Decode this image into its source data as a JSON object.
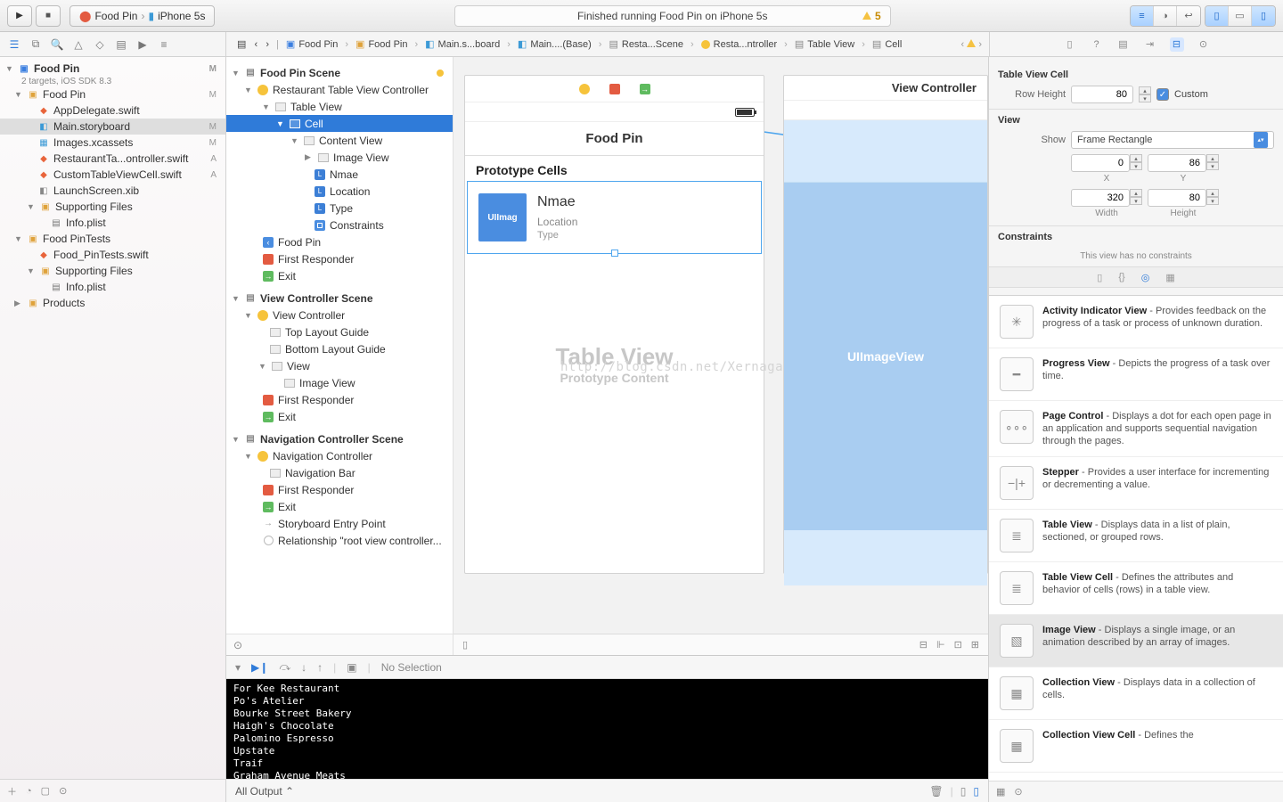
{
  "toolbar": {
    "scheme_app": "Food Pin",
    "scheme_device": "iPhone 5s",
    "status_text": "Finished running Food Pin on iPhone 5s",
    "warning_count": "5"
  },
  "breadcrumb": [
    "Food Pin",
    "Food Pin",
    "Main.s...board",
    "Main....(Base)",
    "Resta...Scene",
    "Resta...ntroller",
    "Table View",
    "Cell"
  ],
  "navigator": {
    "project": {
      "name": "Food Pin",
      "subtitle": "2 targets, iOS SDK 8.3",
      "tag": "M"
    },
    "groups": [
      {
        "name": "Food Pin",
        "tag": "M",
        "items": [
          {
            "name": "AppDelegate.swift",
            "kind": "swift"
          },
          {
            "name": "Main.storyboard",
            "kind": "sb",
            "tag": "M",
            "sel": true
          },
          {
            "name": "Images.xcassets",
            "kind": "xc",
            "tag": "M"
          },
          {
            "name": "RestaurantTa...ontroller.swift",
            "kind": "swift",
            "tag": "A"
          },
          {
            "name": "CustomTableViewCell.swift",
            "kind": "swift",
            "tag": "A"
          },
          {
            "name": "LaunchScreen.xib",
            "kind": "xib"
          }
        ],
        "subgroups": [
          {
            "name": "Supporting Files",
            "items": [
              {
                "name": "Info.plist",
                "kind": "plist"
              }
            ]
          }
        ]
      },
      {
        "name": "Food PinTests",
        "items": [
          {
            "name": "Food_PinTests.swift",
            "kind": "swift"
          }
        ],
        "subgroups": [
          {
            "name": "Supporting Files",
            "items": [
              {
                "name": "Info.plist",
                "kind": "plist"
              }
            ]
          }
        ]
      },
      {
        "name": "Products",
        "collapsed": true
      }
    ]
  },
  "outline": {
    "scenes": [
      {
        "title": "Food Pin Scene",
        "children": [
          {
            "label": "Restaurant Table View Controller",
            "icon": "yellow",
            "children": [
              {
                "label": "Table View",
                "icon": "rect",
                "children": [
                  {
                    "label": "Cell",
                    "icon": "rect",
                    "sel": true,
                    "children": [
                      {
                        "label": "Content View",
                        "icon": "rect",
                        "children": [
                          {
                            "label": "Image View",
                            "icon": "rect",
                            "leaf": true
                          },
                          {
                            "label": "Nmae",
                            "icon": "L"
                          },
                          {
                            "label": "Location",
                            "icon": "L"
                          },
                          {
                            "label": "Type",
                            "icon": "L"
                          },
                          {
                            "label": "Constraints",
                            "icon": "con"
                          }
                        ]
                      }
                    ]
                  }
                ]
              }
            ]
          },
          {
            "label": "Food Pin",
            "icon": "back"
          },
          {
            "label": "First Responder",
            "icon": "cube"
          },
          {
            "label": "Exit",
            "icon": "exit"
          }
        ]
      },
      {
        "title": "View Controller Scene",
        "children": [
          {
            "label": "View Controller",
            "icon": "yellow",
            "children": [
              {
                "label": "Top Layout Guide",
                "icon": "rect"
              },
              {
                "label": "Bottom Layout Guide",
                "icon": "rect"
              },
              {
                "label": "View",
                "icon": "rect",
                "children": [
                  {
                    "label": "Image View",
                    "icon": "rect"
                  }
                ]
              }
            ]
          },
          {
            "label": "First Responder",
            "icon": "cube"
          },
          {
            "label": "Exit",
            "icon": "exit"
          }
        ]
      },
      {
        "title": "Navigation Controller Scene",
        "children": [
          {
            "label": "Navigation Controller",
            "icon": "yellow",
            "children": [
              {
                "label": "Navigation Bar",
                "icon": "rect"
              }
            ]
          },
          {
            "label": "First Responder",
            "icon": "cube"
          },
          {
            "label": "Exit",
            "icon": "exit"
          },
          {
            "label": "Storyboard Entry Point",
            "icon": "arrow"
          },
          {
            "label": "Relationship \"root view controller...",
            "icon": "circle"
          }
        ]
      }
    ]
  },
  "storyboard": {
    "navbar_title": "Food Pin",
    "prototype_header": "Prototype Cells",
    "cell": {
      "img": "UIImag",
      "t1": "Nmae",
      "t2": "Location",
      "t3": "Type"
    },
    "tv_big": "Table View",
    "tv_sm": "Prototype Content",
    "watermark": "http://blog.csdn.net/Xernaga",
    "vc_header": "View Controller",
    "vc_imgview": "UIImageView"
  },
  "inspector": {
    "section1": "Table View Cell",
    "row_height_label": "Row Height",
    "row_height": "80",
    "custom_label": "Custom",
    "section2": "View",
    "show_label": "Show",
    "show_value": "Frame Rectangle",
    "x": "0",
    "y": "86",
    "w": "320",
    "h": "80",
    "x_lbl": "X",
    "y_lbl": "Y",
    "w_lbl": "Width",
    "h_lbl": "Height",
    "constraints_title": "Constraints",
    "constraints_note": "This view has no constraints"
  },
  "library": [
    {
      "title": "Activity Indicator View",
      "desc": "Provides feedback on the progress of a task or process of unknown duration.",
      "glyph": "✳"
    },
    {
      "title": "Progress View",
      "desc": "Depicts the progress of a task over time.",
      "glyph": "━"
    },
    {
      "title": "Page Control",
      "desc": "Displays a dot for each open page in an application and supports sequential navigation through the pages.",
      "glyph": "∘∘∘"
    },
    {
      "title": "Stepper",
      "desc": "Provides a user interface for incrementing or decrementing a value.",
      "glyph": "−|+"
    },
    {
      "title": "Table View",
      "desc": "Displays data in a list of plain, sectioned, or grouped rows.",
      "glyph": "≣"
    },
    {
      "title": "Table View Cell",
      "desc": "Defines the attributes and behavior of cells (rows) in a table view.",
      "glyph": "≣"
    },
    {
      "title": "Image View",
      "desc": "Displays a single image, or an animation described by an array of images.",
      "glyph": "▧",
      "sel": true
    },
    {
      "title": "Collection View",
      "desc": "Displays data in a collection of cells.",
      "glyph": "▦"
    },
    {
      "title": "Collection View Cell",
      "desc": "Defines the",
      "glyph": "▦"
    }
  ],
  "debug": {
    "no_selection": "No Selection",
    "console_lines": [
      "For Kee Restaurant",
      "Po's Atelier",
      "Bourke Street Bakery",
      "Haigh's Chocolate",
      "Palomino Espresso",
      "Upstate",
      "Traif",
      "Graham Avenue Meats"
    ],
    "output_filter": "All Output"
  }
}
